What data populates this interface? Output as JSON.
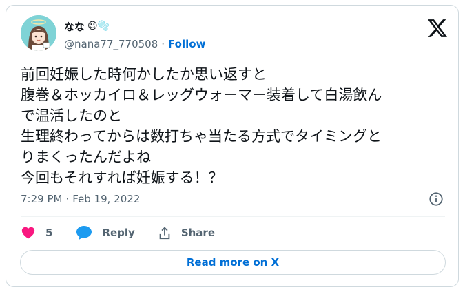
{
  "author": {
    "display_name": "なな",
    "emojis": "☺🫧",
    "handle": "@nana77_770508",
    "follow_label": "Follow"
  },
  "tweet": {
    "lines": [
      "前回妊娠した時何かしたか思い返すと",
      "腹巻＆ホッカイロ＆レッグウォーマー装着して白湯飲ん",
      "で温活したのと",
      "生理終わってからは数打ちゃ当たる方式でタイミングと",
      "りまくったんだよね",
      "今回もそれすれば妊娠する！？"
    ]
  },
  "meta": {
    "time": "7:29 PM",
    "separator": "·",
    "date": "Feb 19, 2022"
  },
  "actions": {
    "like_count": "5",
    "reply_label": "Reply",
    "share_label": "Share"
  },
  "read_more_label": "Read more on X",
  "icons": {
    "logo": "x-logo-icon",
    "like": "heart-icon",
    "reply": "speech-bubble-icon",
    "share": "share-upload-icon",
    "info": "info-icon"
  },
  "colors": {
    "text": "#0f1419",
    "secondary": "#536471",
    "link": "#006fd6",
    "like": "#f91880",
    "reply": "#1d9bf0",
    "avatar_bg": "#7fd3d6"
  }
}
